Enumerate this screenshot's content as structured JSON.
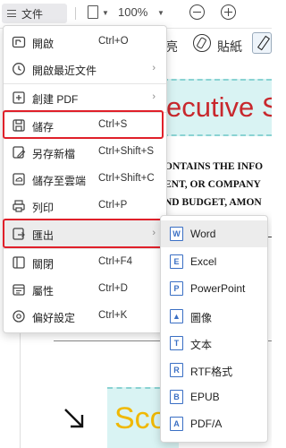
{
  "toolbar": {
    "file_label": "文件",
    "zoom_value": "100%",
    "partial_label": "亮",
    "paste_label": "貼紙"
  },
  "document": {
    "title_fragment": "ecutive S",
    "body_lines": [
      "ONTAINS THE INFO",
      "ENT, OR COMPANY",
      "ND BUDGET, AMON"
    ],
    "score_fragment": "Sco"
  },
  "file_menu": {
    "items": [
      {
        "label": "開啟",
        "shortcut": "Ctrl+O",
        "icon": "folder-open-icon",
        "submenu": false
      },
      {
        "label": "開啟最近文件",
        "shortcut": "",
        "icon": "clock-icon",
        "submenu": true
      },
      {
        "label": "創建 PDF",
        "shortcut": "",
        "icon": "create-pdf-icon",
        "submenu": true
      },
      {
        "label": "儲存",
        "shortcut": "Ctrl+S",
        "icon": "save-icon",
        "submenu": false
      },
      {
        "label": "另存新檔",
        "shortcut": "Ctrl+Shift+S",
        "icon": "save-as-icon",
        "submenu": false
      },
      {
        "label": "儲存至雲端",
        "shortcut": "Ctrl+Shift+C",
        "icon": "cloud-save-icon",
        "submenu": false
      },
      {
        "label": "列印",
        "shortcut": "Ctrl+P",
        "icon": "print-icon",
        "submenu": false
      },
      {
        "label": "匯出",
        "shortcut": "",
        "icon": "export-icon",
        "submenu": true
      },
      {
        "label": "關閉",
        "shortcut": "Ctrl+F4",
        "icon": "close-file-icon",
        "submenu": false
      },
      {
        "label": "屬性",
        "shortcut": "Ctrl+D",
        "icon": "properties-icon",
        "submenu": false
      },
      {
        "label": "偏好設定",
        "shortcut": "Ctrl+K",
        "icon": "gear-icon",
        "submenu": false
      }
    ],
    "highlighted": [
      "儲存",
      "匯出"
    ]
  },
  "export_submenu": {
    "items": [
      {
        "label": "Word",
        "icon": "word-icon",
        "glyph": "W"
      },
      {
        "label": "Excel",
        "icon": "excel-icon",
        "glyph": "E"
      },
      {
        "label": "PowerPoint",
        "icon": "powerpoint-icon",
        "glyph": "P"
      },
      {
        "label": "圖像",
        "icon": "image-icon",
        "glyph": "▲"
      },
      {
        "label": "文本",
        "icon": "text-icon",
        "glyph": "T"
      },
      {
        "label": "RTF格式",
        "icon": "rtf-icon",
        "glyph": "R"
      },
      {
        "label": "EPUB",
        "icon": "epub-icon",
        "glyph": "B"
      },
      {
        "label": "PDF/A",
        "icon": "pdfa-icon",
        "glyph": "A"
      }
    ]
  },
  "colors": {
    "highlight_red": "#e0202a",
    "title_red": "#c8282d",
    "accent_blue": "#3a6fc4",
    "score_yellow": "#f0b800",
    "band_teal": "#d9f3f3"
  }
}
